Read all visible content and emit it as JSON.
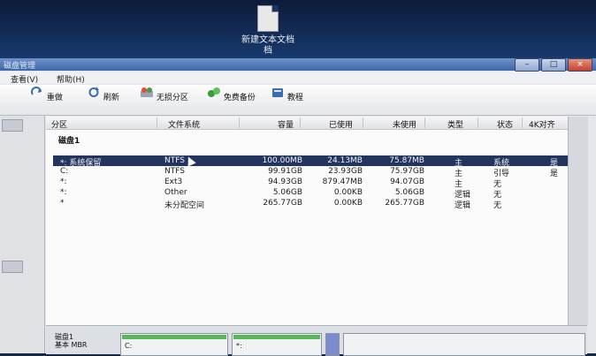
{
  "desktop": {
    "icon_name": "text-file-icon",
    "icon_label": "新建文本文档",
    "icon_label_line2": "档"
  },
  "window": {
    "title": "磁盘管理"
  },
  "menu": {
    "items": [
      "查看(V)",
      "帮助(H)"
    ]
  },
  "toolbar": {
    "items": [
      {
        "label": "重做",
        "icon": "redo-icon"
      },
      {
        "label": "刷新",
        "icon": "refresh-icon"
      },
      {
        "label": "无损分区",
        "icon": "partition-icon"
      },
      {
        "label": "免费备份",
        "icon": "backup-icon"
      },
      {
        "label": "教程",
        "icon": "tutorial-icon"
      }
    ]
  },
  "table": {
    "headers": [
      "分区",
      "文件系统",
      "容量",
      "已使用",
      "未使用",
      "类型",
      "状态",
      "4K对齐"
    ],
    "disk_label": "磁盘1",
    "rows": [
      {
        "partition": "*: 系统保留",
        "fs": "NTFS",
        "capacity": "100.00MB",
        "used": "24.13MB",
        "free": "75.87MB",
        "type": "主",
        "status": "系统",
        "align": "是",
        "selected": true
      },
      {
        "partition": "C:",
        "fs": "NTFS",
        "capacity": "99.91GB",
        "used": "23.93GB",
        "free": "75.97GB",
        "type": "主",
        "status": "引导",
        "align": "是",
        "selected": false
      },
      {
        "partition": "*:",
        "fs": "Ext3",
        "capacity": "94.93GB",
        "used": "879.47MB",
        "free": "94.07GB",
        "type": "主",
        "status": "无",
        "align": "",
        "selected": false
      },
      {
        "partition": "*:",
        "fs": "Other",
        "capacity": "5.06GB",
        "used": "0.00KB",
        "free": "5.06GB",
        "type": "逻辑",
        "status": "无",
        "align": "",
        "selected": false
      },
      {
        "partition": "*",
        "fs": "未分配空间",
        "capacity": "265.77GB",
        "used": "0.00KB",
        "free": "265.77GB",
        "type": "逻辑",
        "status": "无",
        "align": "",
        "selected": false
      }
    ]
  },
  "diskmap": {
    "disk_label": "磁盘1",
    "disk_sub": "基本 MBR",
    "blocks": [
      {
        "label": "C:"
      },
      {
        "label": "*:"
      },
      {
        "label": ""
      }
    ]
  }
}
